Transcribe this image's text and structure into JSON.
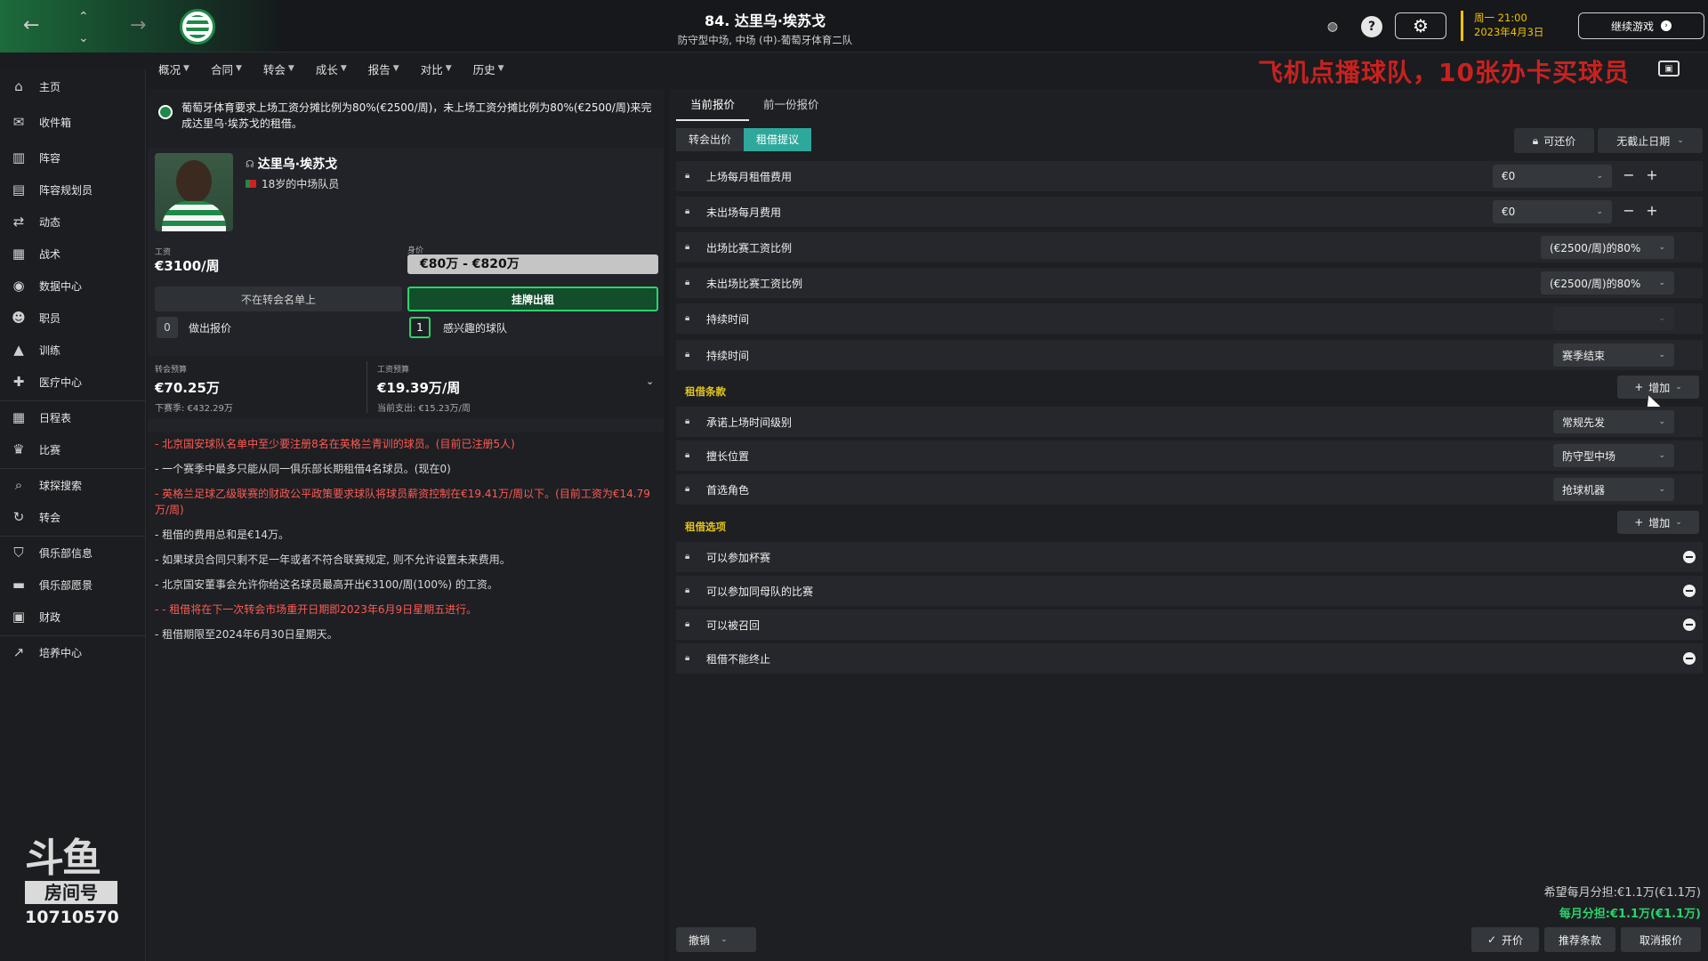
{
  "topbar": {
    "title": "84. 达里乌·埃苏戈",
    "subtitle": "防守型中场, 中场 (中)-葡萄牙体育二队",
    "date_line1": "周一 21:00",
    "date_line2": "2023年4月3日",
    "continue_label": "继续游戏"
  },
  "submenu": {
    "items": [
      "概况",
      "合同",
      "转会",
      "成长",
      "报告",
      "对比",
      "历史"
    ]
  },
  "overlay_banner": "飞机点播球队，10张办卡买球员",
  "sidebar": {
    "items": [
      "主页",
      "收件箱",
      "阵容",
      "阵容规划员",
      "动态",
      "战术",
      "数据中心",
      "职员",
      "训练",
      "医疗中心",
      "日程表",
      "比赛",
      "球探搜索",
      "转会",
      "俱乐部信息",
      "俱乐部愿景",
      "财政",
      "培养中心"
    ]
  },
  "watermark": {
    "logo": "斗鱼",
    "room_label": "房间号",
    "room_number": "10710570"
  },
  "notice": "葡萄牙体育要求上场工资分摊比例为80%(€2500/周)，未上场工资分摊比例为80%(€2500/周)来完成达里乌·埃苏戈的租借。",
  "player": {
    "name": "达里乌·埃苏戈",
    "desc": "18岁的中场队员",
    "wage_label": "工资",
    "wage": "€3100/周",
    "value_label": "身价",
    "value": "€80万 - €820万",
    "not_listed": "不在转会名单上",
    "loan_listed": "挂牌出租",
    "offers_count": "0",
    "offers_label": "做出报价",
    "interested_count": "1",
    "interested_label": "感兴趣的球队"
  },
  "budget": {
    "transfer_label": "转会预算",
    "transfer_value": "€70.25万",
    "transfer_sub": "下赛季: €432.29万",
    "wage_label": "工资预算",
    "wage_value": "€19.39万/周",
    "wage_sub": "当前支出: €15.23万/周"
  },
  "rules": [
    {
      "text": "- 北京国安球队名单中至少要注册8名在英格兰青训的球员。(目前已注册5人)",
      "red": true
    },
    {
      "text": "- 一个赛季中最多只能从同一俱乐部长期租借4名球员。(现在0)",
      "red": false
    },
    {
      "text": "- 英格兰足球乙级联赛的财政公平政策要求球队将球员薪资控制在€19.41万/周以下。(目前工资为€14.79万/周)",
      "red": true
    },
    {
      "text": "- 租借的费用总和是€14万。",
      "red": false
    },
    {
      "text": "- 如果球员合同只剩不足一年或者不符合联赛规定, 则不允许设置未来费用。",
      "red": false
    },
    {
      "text": "- 北京国安董事会允许你给这名球员最高开出€3100/周(100%) 的工资。",
      "red": false
    },
    {
      "text": "- - 租借将在下一次转会市场重开日期即2023年6月9日星期五进行。",
      "red": true
    },
    {
      "text": "- 租借期限至2024年6月30日星期天。",
      "red": false
    }
  ],
  "offer": {
    "tab_current": "当前报价",
    "tab_previous": "前一份报价",
    "seg_transfer": "转会出价",
    "seg_loan": "租借提议",
    "counter_label": "可还价",
    "deadline_label": "无截止日期",
    "rows": [
      {
        "label": "上场每月租借费用",
        "value": "€0"
      },
      {
        "label": "未出场每月费用",
        "value": "€0"
      },
      {
        "label": "出场比赛工资比例",
        "value": "(€2500/周)的80%"
      },
      {
        "label": "未出场比赛工资比例",
        "value": "(€2500/周)的80%"
      },
      {
        "label": "持续时间",
        "value": ""
      },
      {
        "label": "持续时间",
        "value": "赛季结束"
      }
    ],
    "terms_label": "租借条款",
    "terms_add": "增加",
    "terms": [
      {
        "label": "承诺上场时间级别",
        "value": "常规先发"
      },
      {
        "label": "擅长位置",
        "value": "防守型中场"
      },
      {
        "label": "首选角色",
        "value": "抢球机器"
      }
    ],
    "options_label": "租借选项",
    "options_add": "增加",
    "options": [
      "可以参加杯赛",
      "可以参加同母队的比赛",
      "可以被召回",
      "租借不能终止"
    ],
    "summary_hope": "希望每月分担:€1.1万(€1.1万)",
    "summary_actual": "每月分担:€1.1万(€1.1万)",
    "undo": "撤销",
    "open_price": "开价",
    "recommend": "推荐条款",
    "cancel": "取消报价"
  }
}
